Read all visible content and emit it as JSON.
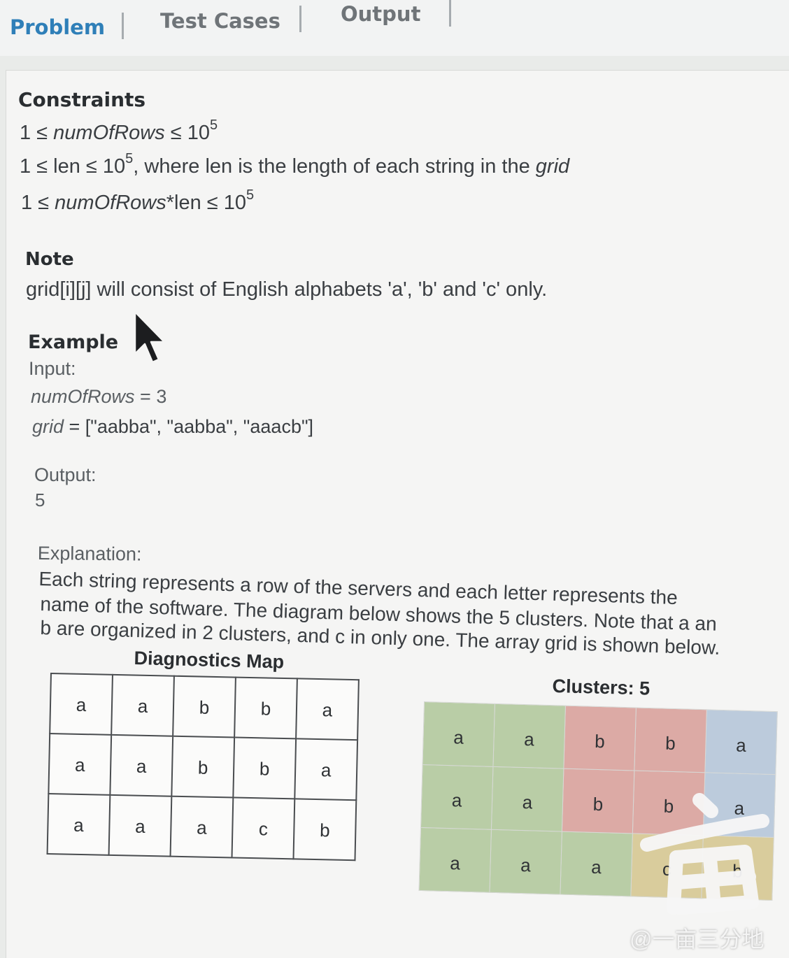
{
  "tabs": [
    {
      "label": "Problem",
      "active": true
    },
    {
      "label": "Test Cases",
      "active": false
    },
    {
      "label": "Output",
      "active": false
    }
  ],
  "constraints": {
    "heading": "Constraints",
    "c1": {
      "pre": "1 ≤ ",
      "var": "numOfRows",
      "post": " ≤ 10",
      "exp": "5"
    },
    "c2": {
      "pre": "1 ≤ len ≤ 10",
      "exp": "5",
      "post": ", where len is the length of each string in the ",
      "var": "grid"
    },
    "c3": {
      "pre": "1 ≤ ",
      "var": "numOfRows",
      "post": "*len ≤ 10",
      "exp": "5"
    }
  },
  "note": {
    "heading": "Note",
    "text": "grid[i][j] will consist of English alphabets 'a', 'b' and 'c' only."
  },
  "example": {
    "heading": "Example",
    "input_label": "Input:",
    "rows_var": "numOfRows",
    "rows_val": " = 3",
    "grid_var": "grid",
    "grid_val": " = [\"aabba\", \"aabba\", \"aaacb\"]",
    "output_label": "Output:",
    "output_value": "5",
    "explanation_label": "Explanation:",
    "explanation_lines": [
      "Each string represents a row of the servers and each letter represents the",
      "name of the software. The diagram below shows the 5 clusters. Note that a an",
      "b are organized in 2 clusters, and c in only one. The array grid is shown below."
    ]
  },
  "diagnostics_map": {
    "title": "Diagnostics Map",
    "rows": [
      [
        "a",
        "a",
        "b",
        "b",
        "a"
      ],
      [
        "a",
        "a",
        "b",
        "b",
        "a"
      ],
      [
        "a",
        "a",
        "a",
        "c",
        "b"
      ]
    ]
  },
  "clusters_map": {
    "title": "Clusters: 5",
    "rows": [
      [
        "a",
        "a",
        "b",
        "b",
        "a"
      ],
      [
        "a",
        "a",
        "b",
        "b",
        "a"
      ],
      [
        "a",
        "a",
        "a",
        "c",
        "b"
      ]
    ],
    "colors": {
      "green": "#b9cda6",
      "red": "#dcaaa5",
      "blue": "#bccbdc",
      "yellow": "#d9cc9c"
    },
    "cell_colors": [
      [
        "green",
        "green",
        "red",
        "red",
        "blue"
      ],
      [
        "green",
        "green",
        "red",
        "red",
        "blue"
      ],
      [
        "green",
        "green",
        "green",
        "yellow",
        "yellow"
      ]
    ]
  },
  "watermark": "@一亩三分地",
  "accent_color": "#2f7fb8"
}
